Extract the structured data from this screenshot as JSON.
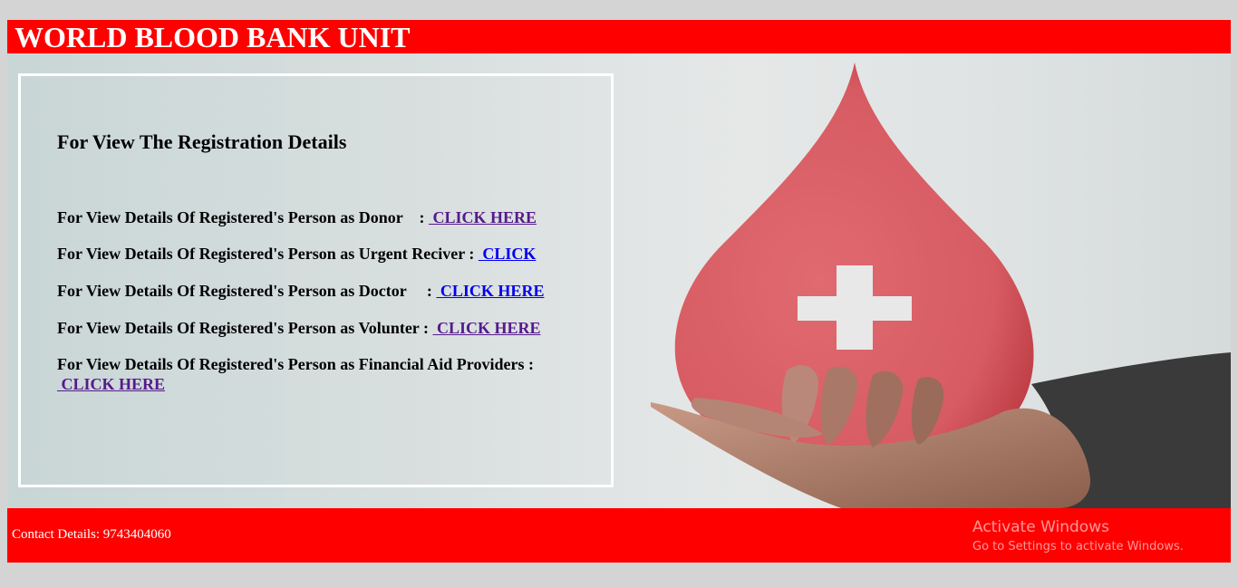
{
  "header": {
    "title": "WORLD BLOOD BANK UNIT"
  },
  "panel": {
    "heading": "For View The Registration Details",
    "rows": [
      {
        "text": "For View Details Of Registered's Person as Donor    : ",
        "link": " CLICK HERE"
      },
      {
        "text": "For View Details Of Registered's Person as Urgent Reciver : ",
        "link": " CLICK"
      },
      {
        "text": "For View Details Of Registered's Person as Doctor     : ",
        "link": " CLICK HERE"
      },
      {
        "text": "For View Details Of Registered's Person as Volunter : ",
        "link": " CLICK HERE"
      },
      {
        "text": "For View Details Of Registered's Person as Financial Aid Providers : ",
        "link": " CLICK HERE"
      }
    ]
  },
  "footer": {
    "contact": "Contact Details: 9743404060"
  },
  "watermark": {
    "title": "Activate Windows",
    "subtitle": "Go to Settings to activate Windows."
  },
  "colors": {
    "brand_red": "#ff0000",
    "visited_link": "#551a8b",
    "link": "#0000ee"
  },
  "icons": {
    "hero_image": "blood-drop-in-hand-with-cross"
  }
}
